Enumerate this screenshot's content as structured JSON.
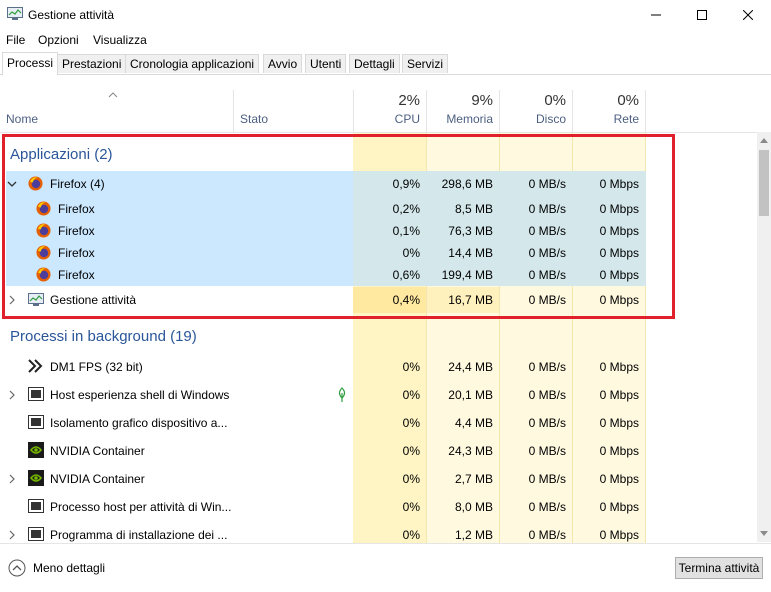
{
  "window": {
    "title": "Gestione attività"
  },
  "menu": [
    "File",
    "Opzioni",
    "Visualizza"
  ],
  "tabs": [
    "Processi",
    "Prestazioni",
    "Cronologia applicazioni",
    "Avvio",
    "Utenti",
    "Dettagli",
    "Servizi"
  ],
  "header": {
    "name": "Nome",
    "status": "Stato",
    "cpu": {
      "pct": "2%",
      "label": "CPU"
    },
    "memory": {
      "pct": "9%",
      "label": "Memoria"
    },
    "disk": {
      "pct": "0%",
      "label": "Disco"
    },
    "network": {
      "pct": "0%",
      "label": "Rete"
    }
  },
  "groups": {
    "apps": "Applicazioni (2)",
    "background": "Processi in background (19)"
  },
  "rows": {
    "firefox_parent": {
      "name": "Firefox (4)",
      "cpu": "0,9%",
      "mem": "298,6 MB",
      "disk": "0 MB/s",
      "net": "0 Mbps"
    },
    "firefox_children": [
      {
        "name": "Firefox",
        "cpu": "0,2%",
        "mem": "8,5 MB",
        "disk": "0 MB/s",
        "net": "0 Mbps"
      },
      {
        "name": "Firefox",
        "cpu": "0,1%",
        "mem": "76,3 MB",
        "disk": "0 MB/s",
        "net": "0 Mbps"
      },
      {
        "name": "Firefox",
        "cpu": "0%",
        "mem": "14,4 MB",
        "disk": "0 MB/s",
        "net": "0 Mbps"
      },
      {
        "name": "Firefox",
        "cpu": "0,6%",
        "mem": "199,4 MB",
        "disk": "0 MB/s",
        "net": "0 Mbps"
      }
    ],
    "taskmgr": {
      "name": "Gestione attività",
      "cpu": "0,4%",
      "mem": "16,7 MB",
      "disk": "0 MB/s",
      "net": "0 Mbps"
    },
    "background": [
      {
        "name": "DM1 FPS (32 bit)",
        "cpu": "0%",
        "mem": "24,4 MB",
        "disk": "0 MB/s",
        "net": "0 Mbps",
        "icon": "dm1-icon"
      },
      {
        "name": "Host esperienza shell di Windows",
        "cpu": "0%",
        "mem": "20,1 MB",
        "disk": "0 MB/s",
        "net": "0 Mbps",
        "icon": "window-icon"
      },
      {
        "name": "Isolamento grafico dispositivo a...",
        "cpu": "0%",
        "mem": "4,4 MB",
        "disk": "0 MB/s",
        "net": "0 Mbps",
        "icon": "window-icon"
      },
      {
        "name": "NVIDIA Container",
        "cpu": "0%",
        "mem": "24,3 MB",
        "disk": "0 MB/s",
        "net": "0 Mbps",
        "icon": "nvidia-icon"
      },
      {
        "name": "NVIDIA Container",
        "cpu": "0%",
        "mem": "2,7 MB",
        "disk": "0 MB/s",
        "net": "0 Mbps",
        "icon": "nvidia-icon"
      },
      {
        "name": "Processo host per attività di Win...",
        "cpu": "0%",
        "mem": "8,0 MB",
        "disk": "0 MB/s",
        "net": "0 Mbps",
        "icon": "window-icon"
      },
      {
        "name": "Programma di installazione dei ...",
        "cpu": "0%",
        "mem": "1,2 MB",
        "disk": "0 MB/s",
        "net": "0 Mbps",
        "icon": "window-icon"
      }
    ]
  },
  "footer": {
    "less_details": "Meno dettagli",
    "end_task": "Termina attività"
  },
  "colors": {
    "accent_blue": "#2a5699",
    "selection": "#cce8ff",
    "heat_yellow": "#fff4c4",
    "highlight_red": "#e0202a"
  }
}
